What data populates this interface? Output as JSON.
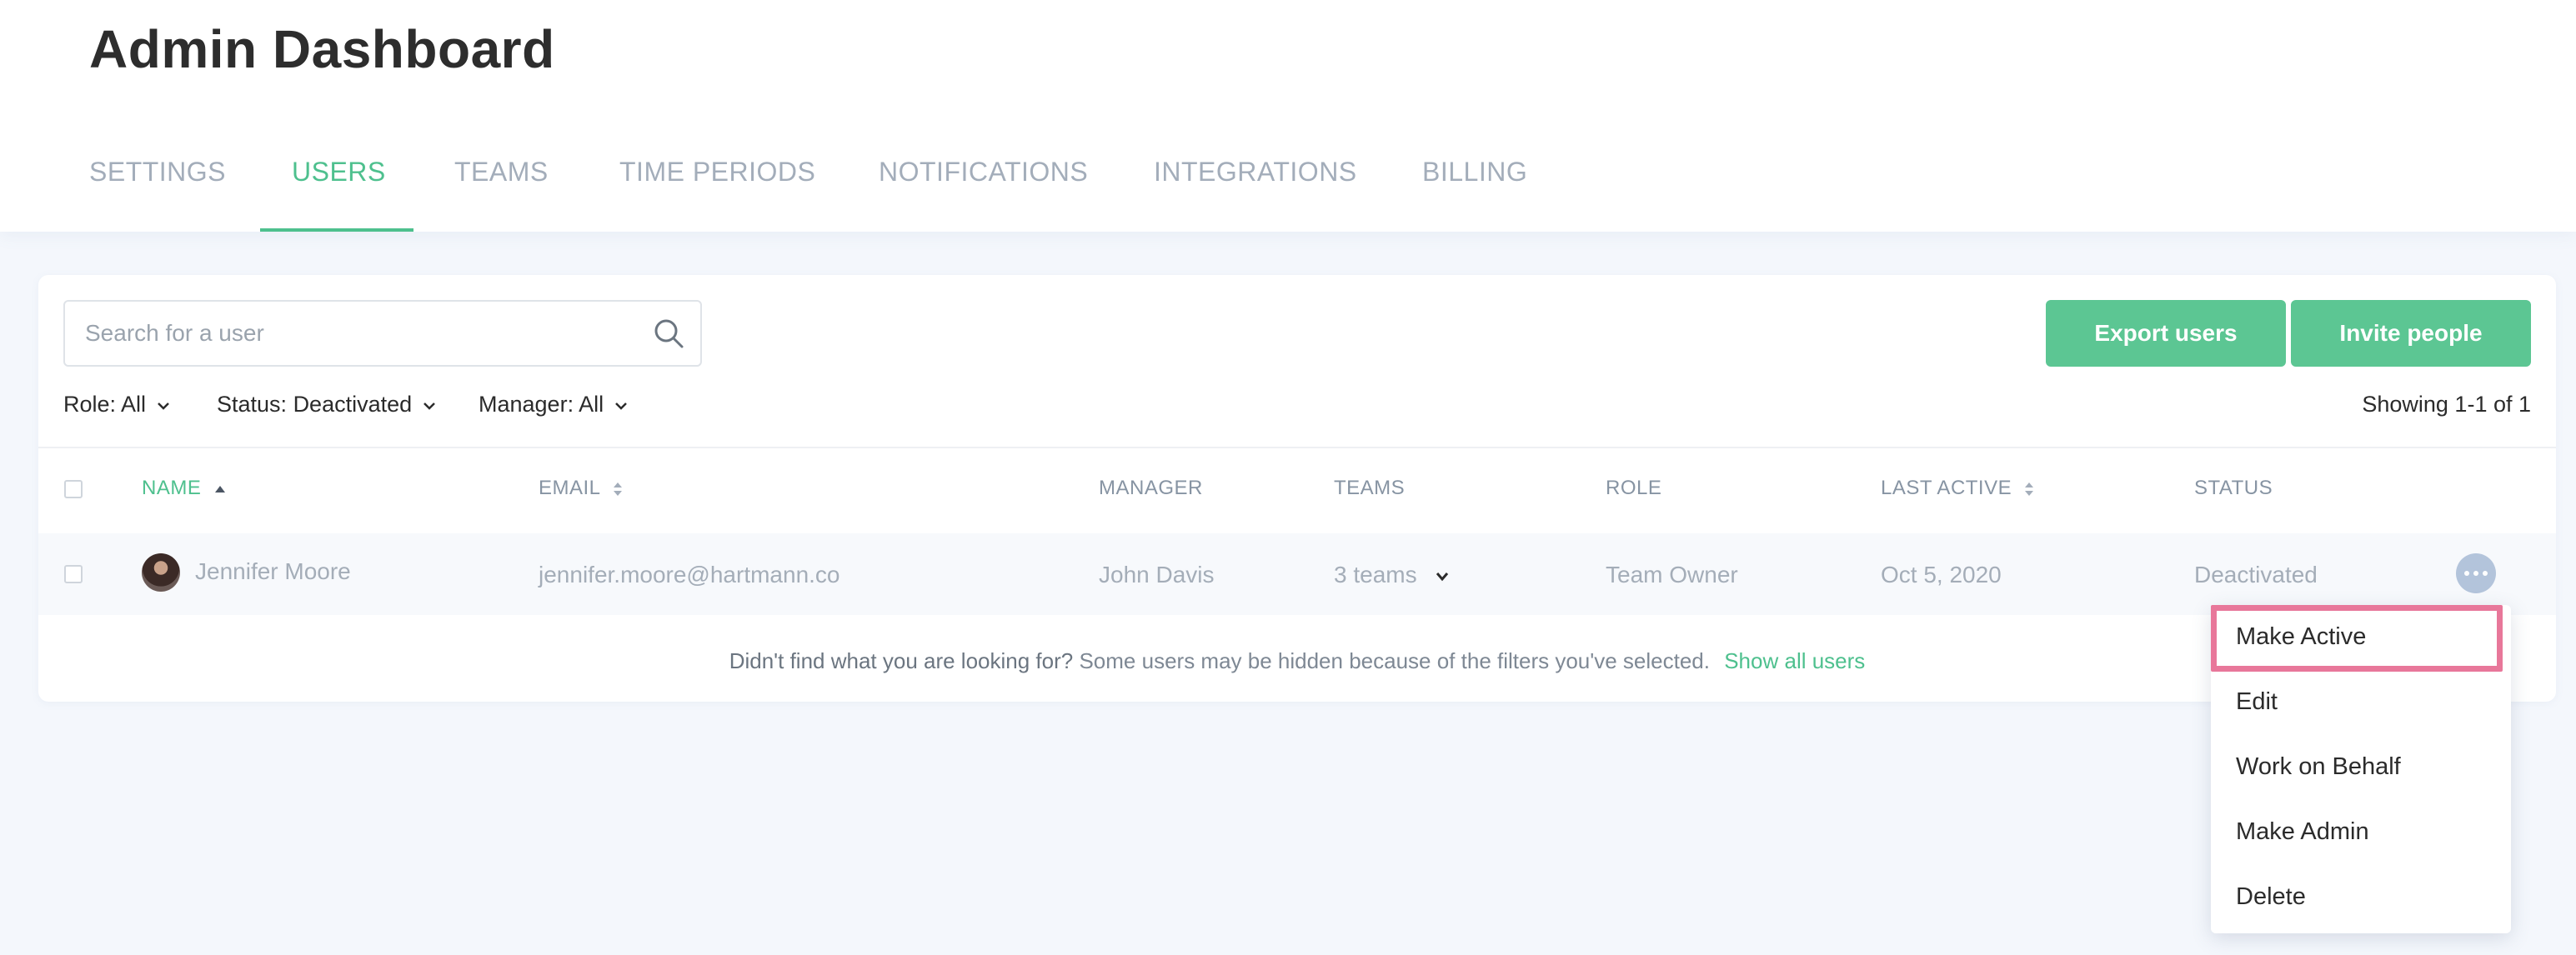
{
  "header": {
    "title": "Admin Dashboard",
    "tabs": [
      {
        "label": "SETTINGS",
        "active": false
      },
      {
        "label": "USERS",
        "active": true
      },
      {
        "label": "TEAMS",
        "active": false
      },
      {
        "label": "TIME PERIODS",
        "active": false
      },
      {
        "label": "NOTIFICATIONS",
        "active": false
      },
      {
        "label": "INTEGRATIONS",
        "active": false
      },
      {
        "label": "BILLING",
        "active": false
      }
    ]
  },
  "toolbar": {
    "search_placeholder": "Search for a user",
    "search_value": "",
    "export_label": "Export users",
    "invite_label": "Invite people"
  },
  "filters": {
    "role_label": "Role:",
    "role_value": "All",
    "status_label": "Status:",
    "status_value": "Deactivated",
    "manager_label": "Manager:",
    "manager_value": "All",
    "showing": "Showing 1-1 of 1"
  },
  "table": {
    "columns": {
      "name": "NAME",
      "email": "EMAIL",
      "manager": "MANAGER",
      "teams": "TEAMS",
      "role": "ROLE",
      "last_active": "LAST ACTIVE",
      "status": "STATUS"
    },
    "rows": [
      {
        "name": "Jennifer Moore",
        "email": "jennifer.moore@hartmann.co",
        "manager": "John Davis",
        "teams": "3 teams",
        "role": "Team Owner",
        "last_active": "Oct 5, 2020",
        "status": "Deactivated"
      }
    ]
  },
  "footer": {
    "lead": "Didn't find what you are looking for?",
    "note": "Some users may be hidden because of the filters you've selected.",
    "link": "Show all users"
  },
  "menu": {
    "items": [
      "Make Active",
      "Edit",
      "Work on Behalf",
      "Make Admin",
      "Delete"
    ],
    "highlighted": "Make Active"
  },
  "colors": {
    "accent": "#4ec08e",
    "button": "#5cc693",
    "highlight": "#e8779a",
    "more_button": "#b3c4db"
  },
  "icons": {
    "search": "search-icon",
    "more": "more-horizontal-icon",
    "chevron": "chevron-down-icon",
    "sort": "sort-icon"
  }
}
